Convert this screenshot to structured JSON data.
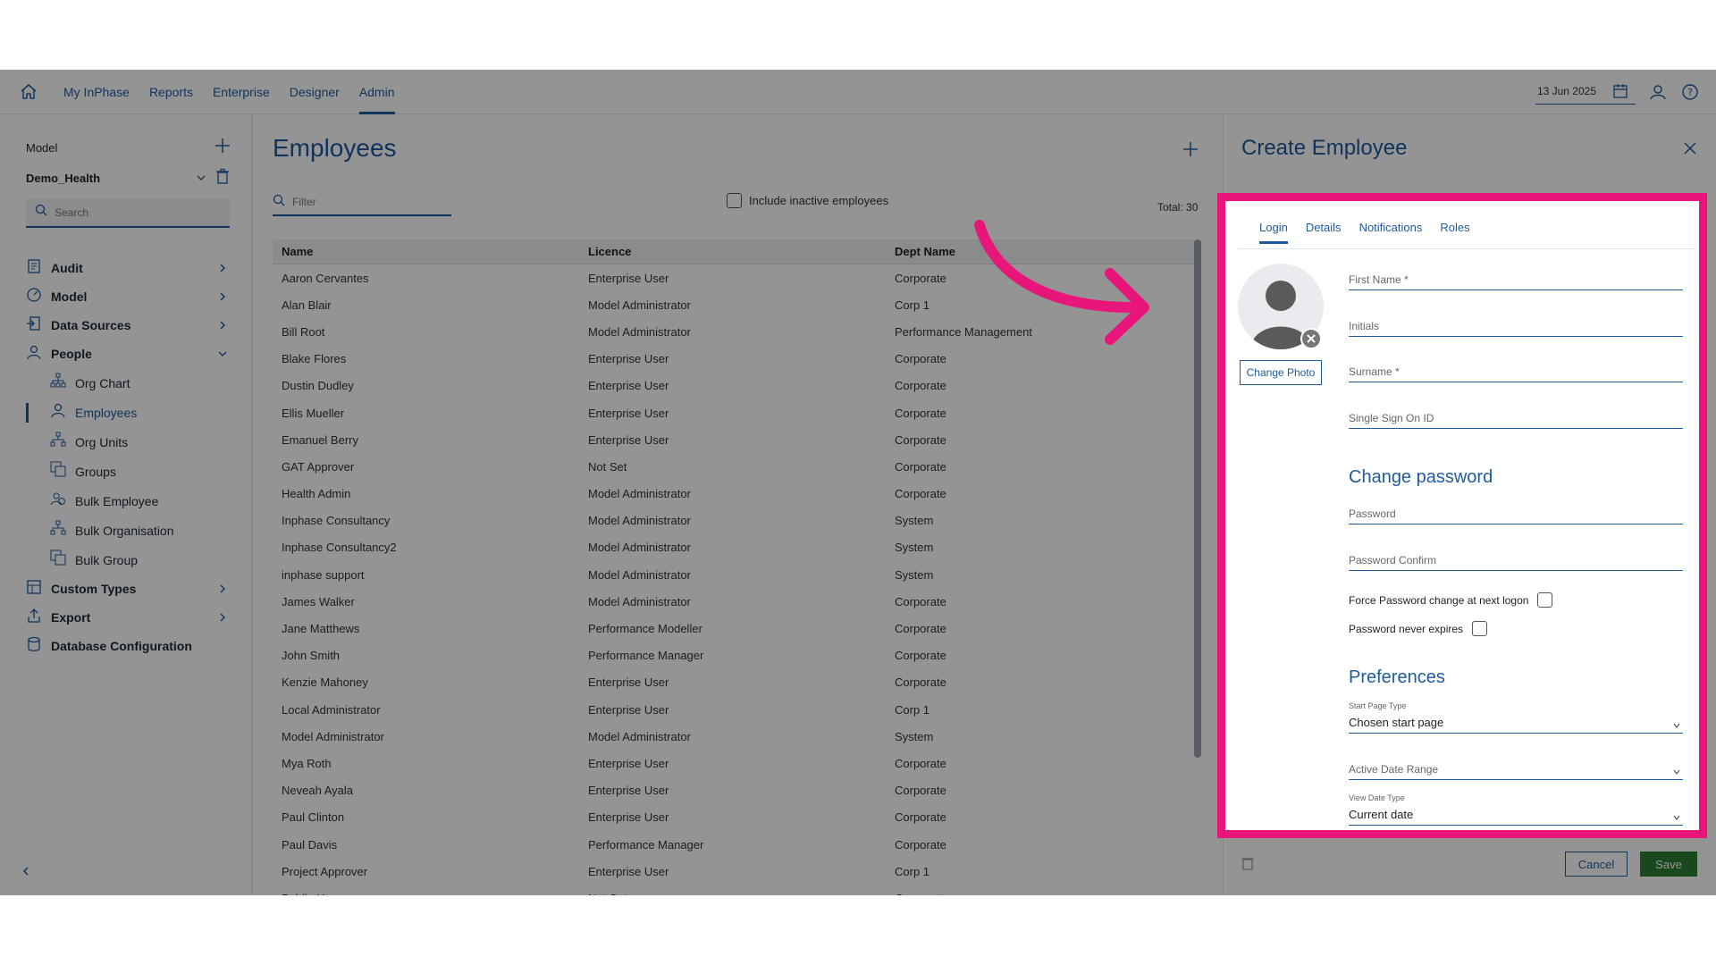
{
  "nav": {
    "tabs": [
      "My InPhase",
      "Reports",
      "Enterprise",
      "Designer",
      "Admin"
    ],
    "active_tab": "Admin",
    "date": "13 Jun 2025"
  },
  "sidebar": {
    "label": "Model",
    "model_name": "Demo_Health",
    "search_placeholder": "Search",
    "items": [
      {
        "label": "Audit",
        "icon": "audit-icon"
      },
      {
        "label": "Model",
        "icon": "model-icon"
      },
      {
        "label": "Data Sources",
        "icon": "data-sources-icon"
      },
      {
        "label": "People",
        "icon": "people-icon",
        "expanded": true
      },
      {
        "label": "Custom Types",
        "icon": "custom-types-icon"
      },
      {
        "label": "Export",
        "icon": "export-icon"
      },
      {
        "label": "Database Configuration",
        "icon": "database-icon"
      }
    ],
    "people_children": [
      {
        "label": "Org Chart",
        "icon": "org-chart-icon"
      },
      {
        "label": "Employees",
        "icon": "employee-icon",
        "active": true
      },
      {
        "label": "Org Units",
        "icon": "org-units-icon"
      },
      {
        "label": "Groups",
        "icon": "groups-icon"
      },
      {
        "label": "Bulk Employee",
        "icon": "bulk-employee-icon"
      },
      {
        "label": "Bulk Organisation",
        "icon": "bulk-org-icon"
      },
      {
        "label": "Bulk Group",
        "icon": "bulk-group-icon"
      }
    ]
  },
  "employees": {
    "title": "Employees",
    "filter_placeholder": "Filter",
    "include_inactive_label": "Include inactive employees",
    "total_label": "Total: 30",
    "columns": [
      "Name",
      "Licence",
      "Dept Name"
    ],
    "rows": [
      [
        "Aaron Cervantes",
        "Enterprise User",
        "Corporate"
      ],
      [
        "Alan Blair",
        "Model Administrator",
        "Corp 1"
      ],
      [
        "Bill Root",
        "Model Administrator",
        "Performance Management"
      ],
      [
        "Blake Flores",
        "Enterprise User",
        "Corporate"
      ],
      [
        "Dustin Dudley",
        "Enterprise User",
        "Corporate"
      ],
      [
        "Ellis Mueller",
        "Enterprise User",
        "Corporate"
      ],
      [
        "Emanuel Berry",
        "Enterprise User",
        "Corporate"
      ],
      [
        "GAT Approver",
        "Not Set",
        "Corporate"
      ],
      [
        "Health Admin",
        "Model Administrator",
        "Corporate"
      ],
      [
        "Inphase Consultancy",
        "Model Administrator",
        "System"
      ],
      [
        "Inphase Consultancy2",
        "Model Administrator",
        "System"
      ],
      [
        "inphase support",
        "Model Administrator",
        "System"
      ],
      [
        "James Walker",
        "Model Administrator",
        "Corporate"
      ],
      [
        "Jane Matthews",
        "Performance Modeller",
        "Corporate"
      ],
      [
        "John Smith",
        "Performance Manager",
        "Corporate"
      ],
      [
        "Kenzie Mahoney",
        "Enterprise User",
        "Corporate"
      ],
      [
        "Local Administrator",
        "Enterprise User",
        "Corp 1"
      ],
      [
        "Model Administrator",
        "Model Administrator",
        "System"
      ],
      [
        "Mya Roth",
        "Enterprise User",
        "Corporate"
      ],
      [
        "Neveah Ayala",
        "Enterprise User",
        "Corporate"
      ],
      [
        "Paul Clinton",
        "Enterprise User",
        "Corporate"
      ],
      [
        "Paul Davis",
        "Performance Manager",
        "Corporate"
      ],
      [
        "Project Approver",
        "Enterprise User",
        "Corp 1"
      ],
      [
        "Public User",
        "Not Set",
        "Corporate"
      ]
    ]
  },
  "create_employee": {
    "title": "Create Employee",
    "tabs": [
      "Login",
      "Details",
      "Notifications",
      "Roles"
    ],
    "active_tab": "Login",
    "change_photo": "Change Photo",
    "fields": {
      "first_name": "First Name *",
      "initials": "Initials",
      "surname": "Surname *",
      "sso_id": "Single Sign On ID"
    },
    "change_password_heading": "Change password",
    "password": "Password",
    "password_confirm": "Password Confirm",
    "force_change_label": "Force Password change at next logon",
    "never_expires_label": "Password never expires",
    "preferences_heading": "Preferences",
    "start_page_type_label": "Start Page Type",
    "start_page_type_value": "Chosen start page",
    "active_date_range": "Active Date Range",
    "view_date_type_label": "View Date Type",
    "view_date_type_value": "Current date",
    "cancel": "Cancel",
    "save": "Save"
  },
  "colors": {
    "accent": "#1f5a9e",
    "highlight": "#e8157a",
    "save": "#2e7d32"
  }
}
